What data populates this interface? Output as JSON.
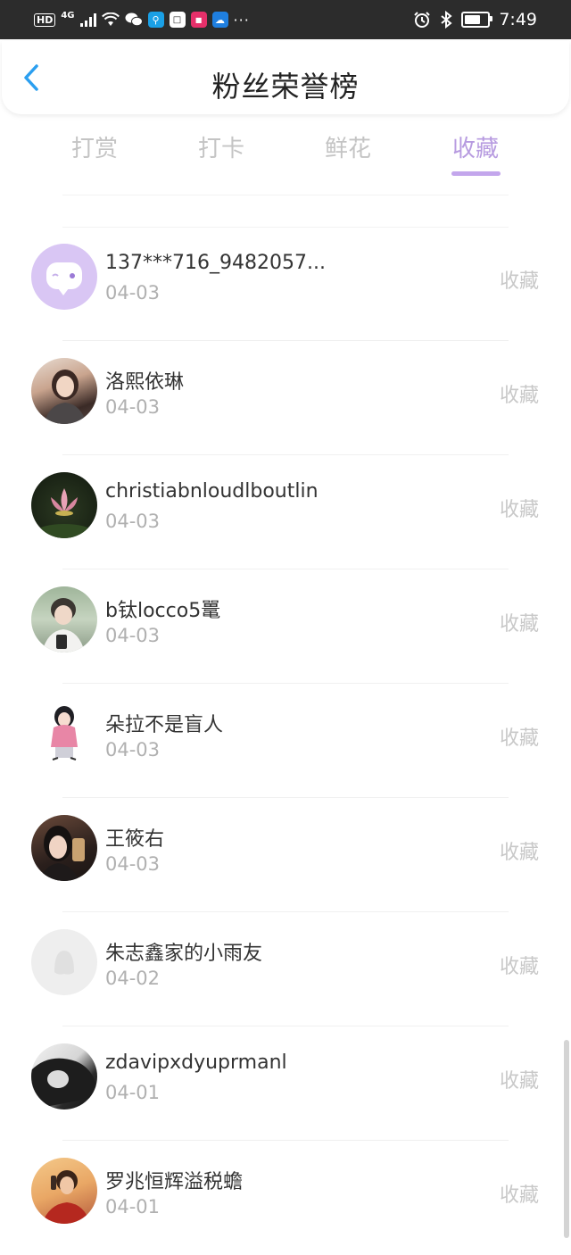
{
  "status_bar": {
    "hd": "HD",
    "network": "4G",
    "time": "7:49",
    "battery_level": 0.6,
    "dots": "···"
  },
  "header": {
    "title": "粉丝荣誉榜"
  },
  "tabs": [
    {
      "label": "打赏",
      "active": false
    },
    {
      "label": "打卡",
      "active": false
    },
    {
      "label": "鲜花",
      "active": false
    },
    {
      "label": "收藏",
      "active": true
    }
  ],
  "colors": {
    "accent": "#b79be0",
    "underline": "#c3a6ec",
    "inactive_tab": "#c4c4c4",
    "action_text": "#c8c8c8"
  },
  "list": [
    {
      "name": "137***716_9482057...",
      "date": "04-03",
      "action": "收藏",
      "avatar": "default-chat-avatar"
    },
    {
      "name": "洛熙依琳",
      "date": "04-03",
      "action": "收藏",
      "avatar": "user-photo-avatar"
    },
    {
      "name": "christiabnloudlboutlin",
      "date": "04-03",
      "action": "收藏",
      "avatar": "lotus-photo-avatar"
    },
    {
      "name": "b钛locco5鼍",
      "date": "04-03",
      "action": "收藏",
      "avatar": "user-photo-avatar"
    },
    {
      "name": "朵拉不是盲人",
      "date": "04-03",
      "action": "收藏",
      "avatar": "illustration-avatar"
    },
    {
      "name": "王筱右",
      "date": "04-03",
      "action": "收藏",
      "avatar": "user-photo-avatar"
    },
    {
      "name": "朱志鑫家的小雨友",
      "date": "04-02",
      "action": "收藏",
      "avatar": "placeholder-avatar"
    },
    {
      "name": "zdavipxdyuprmanl",
      "date": "04-01",
      "action": "收藏",
      "avatar": "bw-photo-avatar"
    },
    {
      "name": "罗兆恒辉溢税蟾",
      "date": "04-01",
      "action": "收藏",
      "avatar": "user-photo-avatar"
    }
  ]
}
